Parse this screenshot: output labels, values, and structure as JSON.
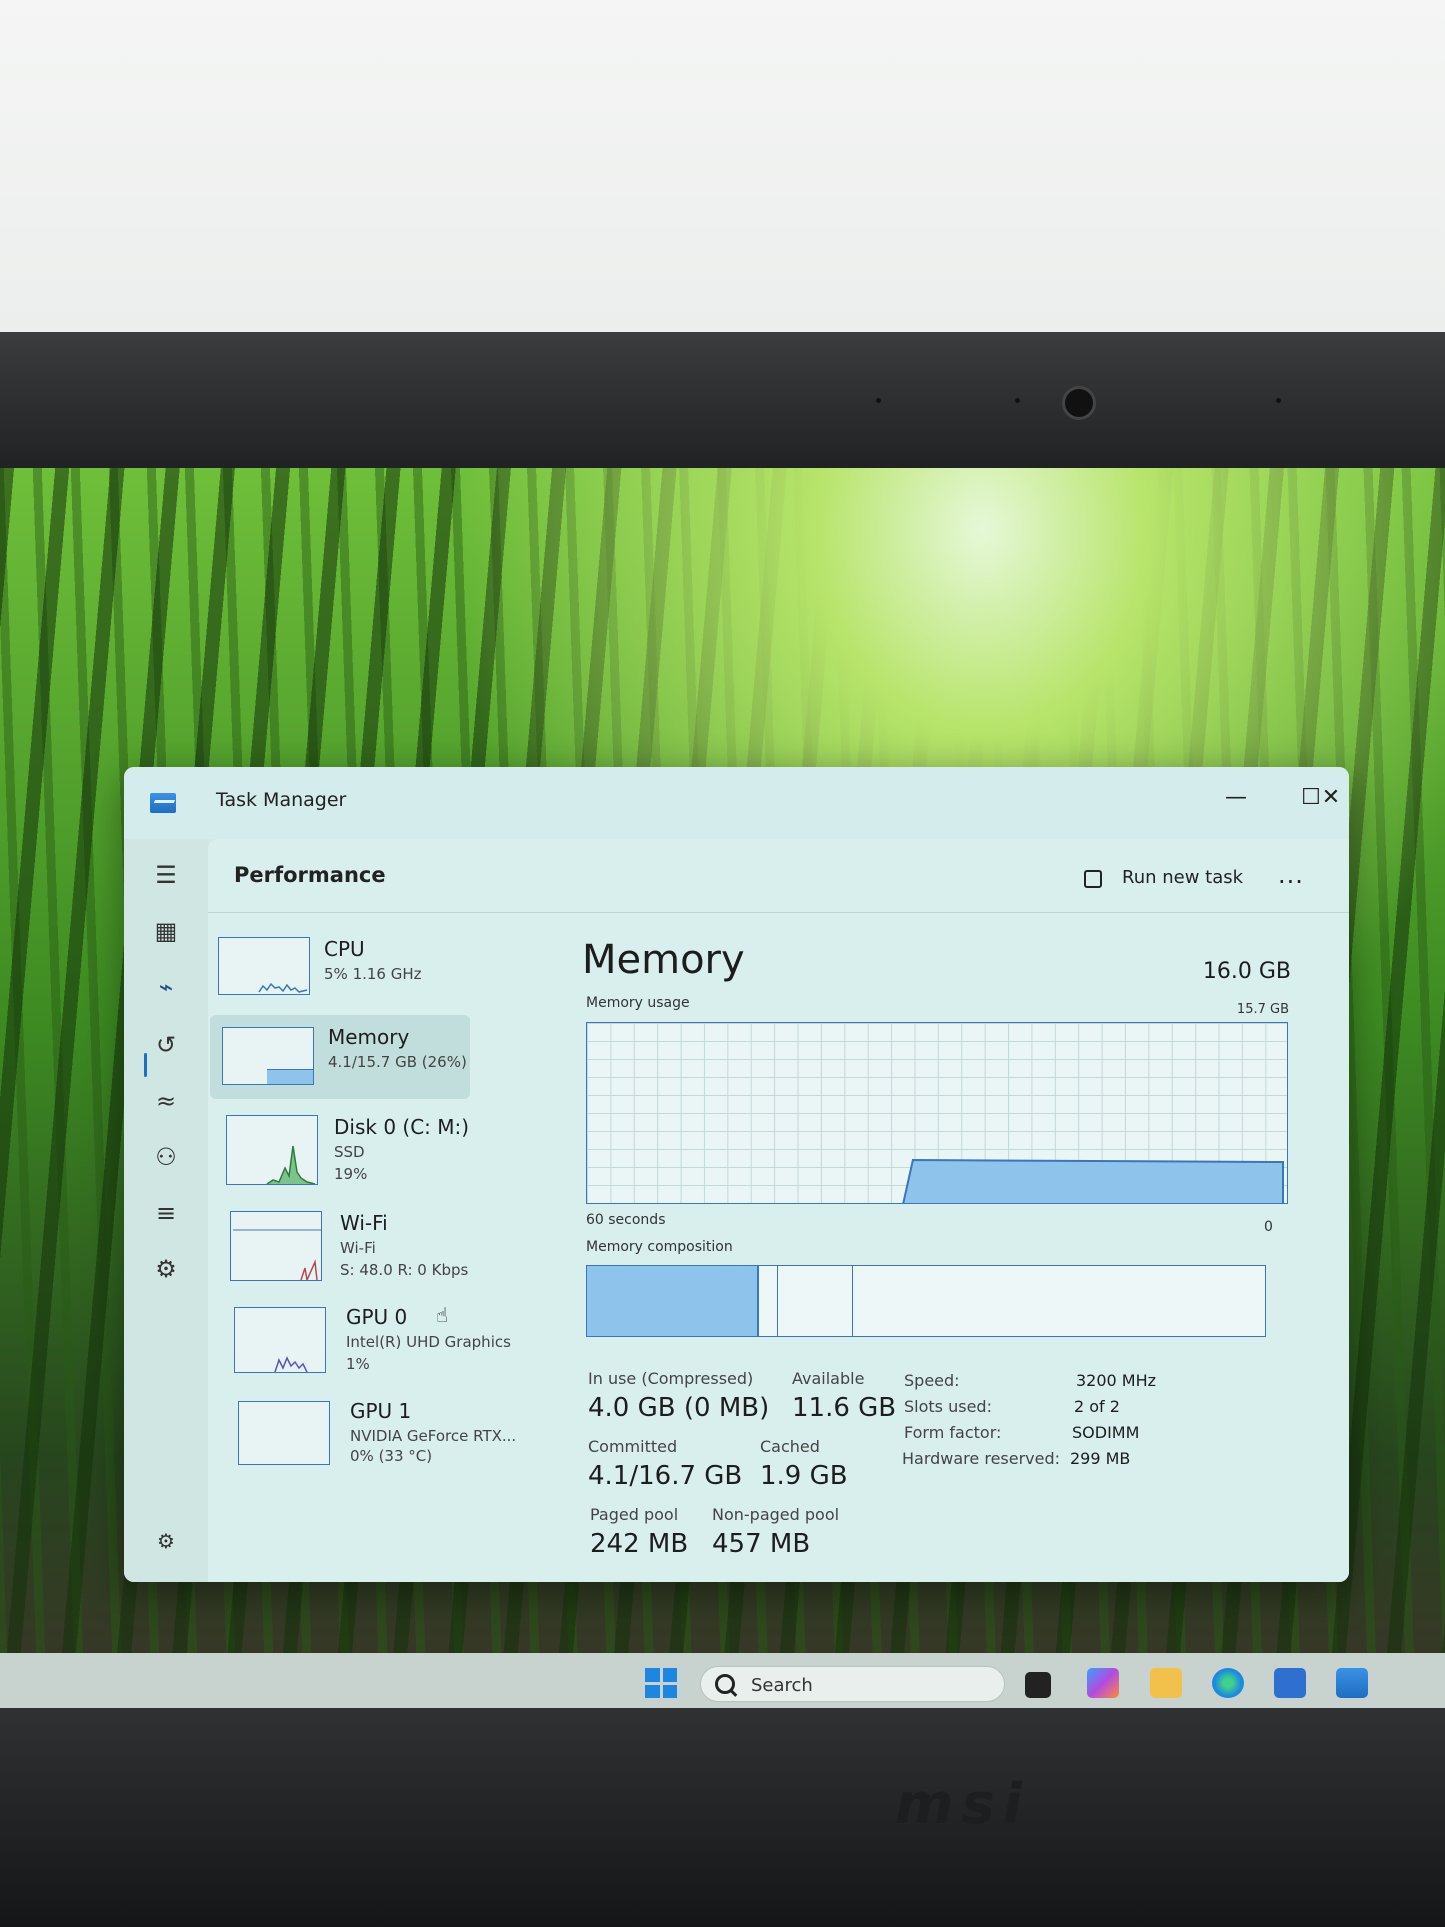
{
  "window": {
    "title": "Task Manager",
    "minimize": "—",
    "maximize": "☐",
    "close": "✕"
  },
  "toolbar": {
    "page_title": "Performance",
    "run_new_task": "Run new task",
    "more": "..."
  },
  "sidebar": {
    "items": [
      {
        "icon": "hamburger-menu-icon",
        "glyph": "☰"
      },
      {
        "icon": "processes-icon",
        "glyph": "▦"
      },
      {
        "icon": "performance-icon",
        "glyph": "⌁"
      },
      {
        "icon": "app-history-icon",
        "glyph": "↺"
      },
      {
        "icon": "startup-apps-icon",
        "glyph": "≈"
      },
      {
        "icon": "users-icon",
        "glyph": "⚇"
      },
      {
        "icon": "details-icon",
        "glyph": "≡"
      },
      {
        "icon": "services-icon",
        "glyph": "⚙"
      }
    ],
    "settings_glyph": "⚙"
  },
  "devices": [
    {
      "name": "CPU",
      "line1": "5%  1.16 GHz",
      "line2": ""
    },
    {
      "name": "Memory",
      "line1": "4.1/15.7 GB (26%)",
      "line2": ""
    },
    {
      "name": "Disk 0 (C: M:)",
      "line1": "SSD",
      "line2": "19%"
    },
    {
      "name": "Wi-Fi",
      "line1": "Wi-Fi",
      "line2": "S: 48.0  R: 0 Kbps"
    },
    {
      "name": "GPU 0",
      "line1": "Intel(R) UHD Graphics",
      "line2": "1%"
    },
    {
      "name": "GPU 1",
      "line1": "NVIDIA GeForce RTX...",
      "line2": "0%  (33 °C)"
    }
  ],
  "memory": {
    "heading": "Memory",
    "total": "16.0 GB",
    "usage_label": "Memory usage",
    "usage_max": "15.7 GB",
    "time_left": "60 seconds",
    "time_right": "0",
    "composition_label": "Memory composition",
    "composition": {
      "in_use_fraction": 0.25,
      "modified_fraction": 0.03,
      "standby_fraction": 0.11
    },
    "usage_level_fraction": 0.26,
    "stats": {
      "in_use_label": "In use (Compressed)",
      "in_use_value": "4.0 GB (0 MB)",
      "available_label": "Available",
      "available_value": "11.6 GB",
      "committed_label": "Committed",
      "committed_value": "4.1/16.7 GB",
      "cached_label": "Cached",
      "cached_value": "1.9 GB",
      "paged_label": "Paged pool",
      "paged_value": "242 MB",
      "nonpaged_label": "Non-paged pool",
      "nonpaged_value": "457 MB"
    },
    "specs": [
      {
        "key": "Speed:",
        "value": "3200 MHz"
      },
      {
        "key": "Slots used:",
        "value": "2 of 2"
      },
      {
        "key": "Form factor:",
        "value": "SODIMM"
      },
      {
        "key": "Hardware reserved:",
        "value": "299 MB"
      }
    ]
  },
  "taskbar": {
    "search_label": "Search"
  },
  "brand": "msi",
  "colors": {
    "accent": "#1f6fc8",
    "graph_fill": "#8ec3ec",
    "graph_line": "#3b76bb"
  }
}
